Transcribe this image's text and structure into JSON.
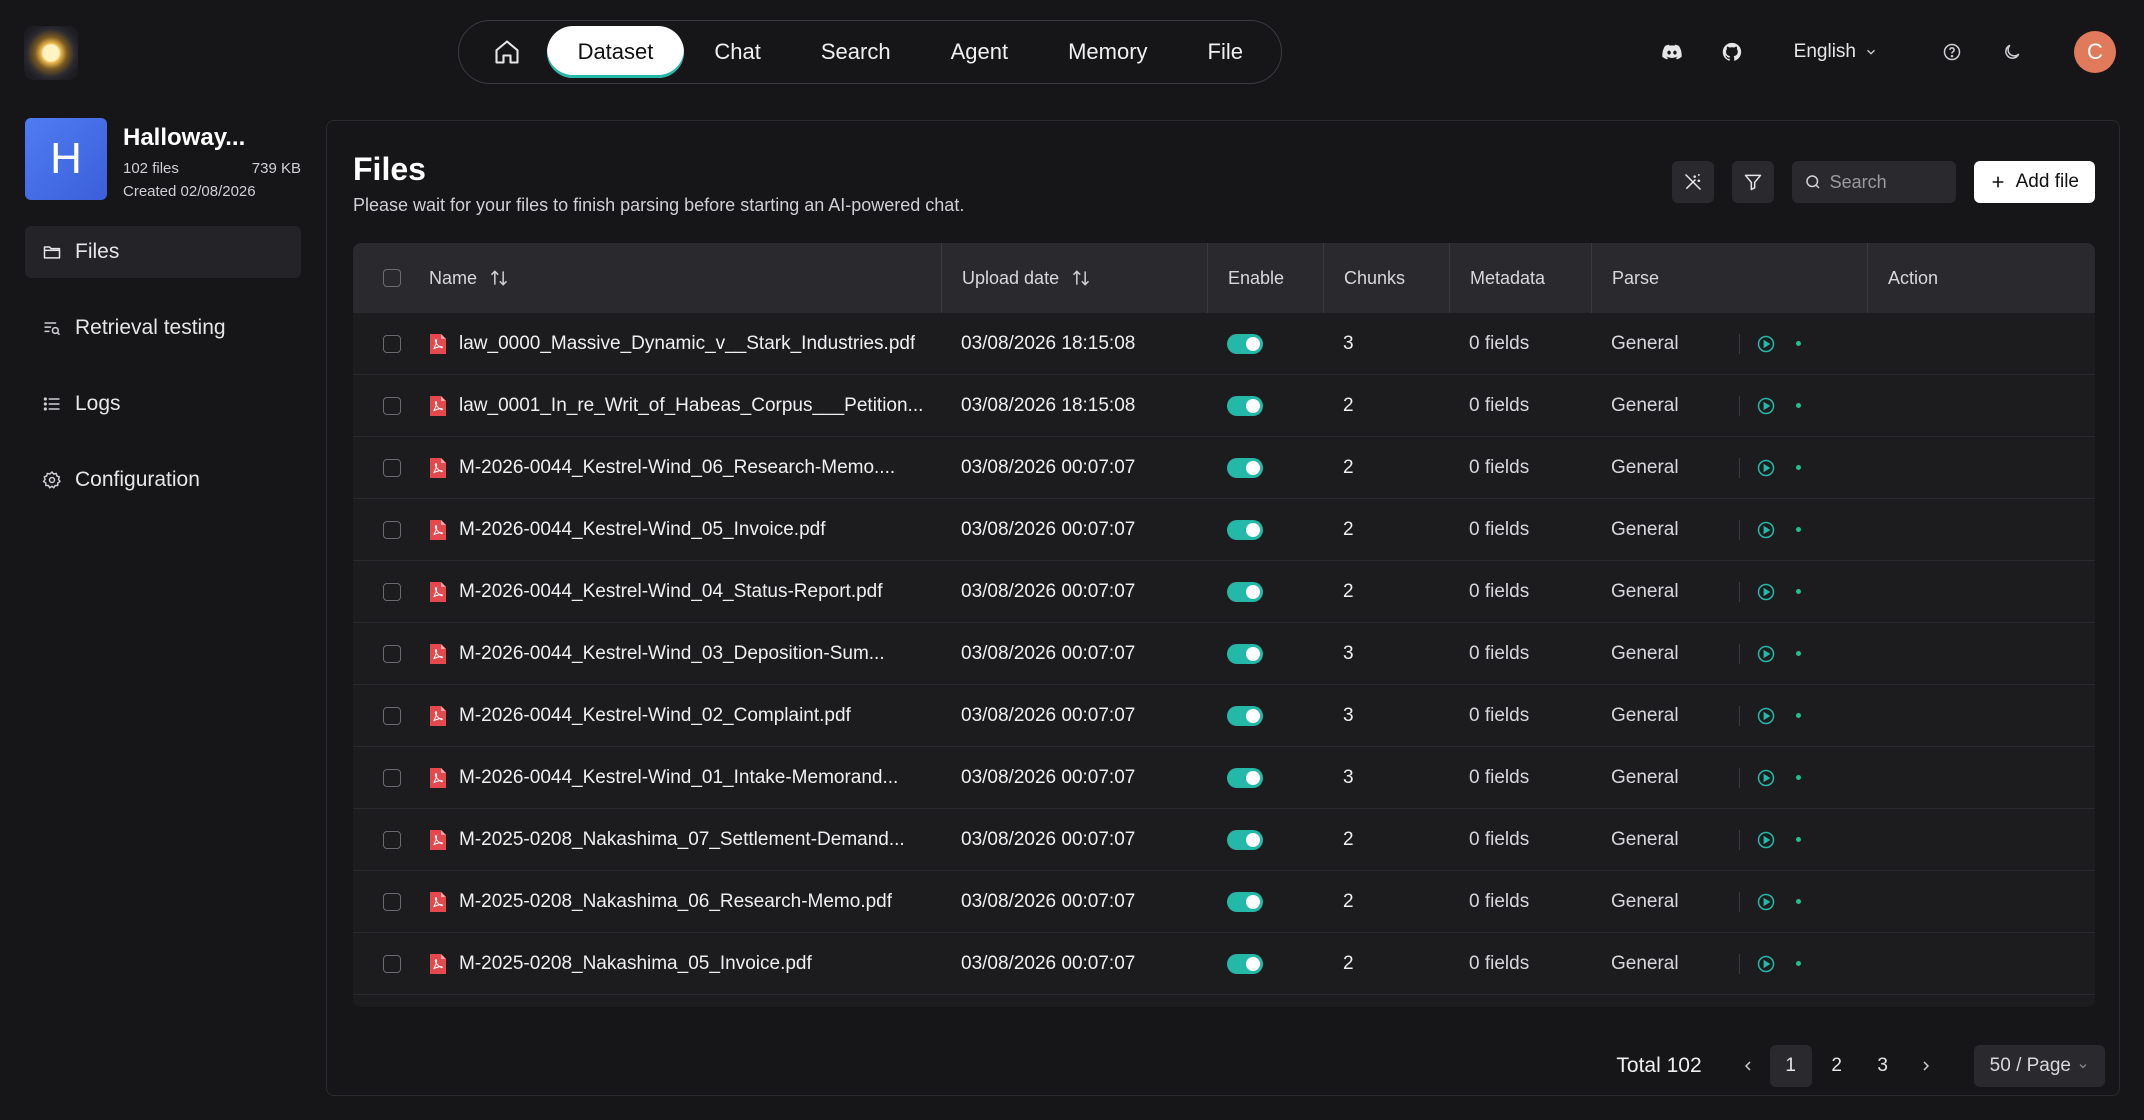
{
  "nav": {
    "items": [
      {
        "label": "Dataset",
        "active": true
      },
      {
        "label": "Chat",
        "active": false
      },
      {
        "label": "Search",
        "active": false
      },
      {
        "label": "Agent",
        "active": false
      },
      {
        "label": "Memory",
        "active": false
      },
      {
        "label": "File",
        "active": false
      }
    ]
  },
  "topright": {
    "language": "English",
    "avatar_initial": "C"
  },
  "dataset": {
    "thumb_letter": "H",
    "name": "Halloway...",
    "files": "102 files",
    "size": "739 KB",
    "created": "Created 02/08/2026"
  },
  "sidebar": {
    "items": [
      {
        "label": "Files",
        "icon": "folder-icon",
        "active": true
      },
      {
        "label": "Retrieval testing",
        "icon": "retrieval-icon",
        "active": false
      },
      {
        "label": "Logs",
        "icon": "list-icon",
        "active": false
      },
      {
        "label": "Configuration",
        "icon": "gear-icon",
        "active": false
      }
    ]
  },
  "page": {
    "title": "Files",
    "subtitle": "Please wait for your files to finish parsing before starting an AI-powered chat.",
    "search_placeholder": "Search",
    "add_file_label": "Add file"
  },
  "table": {
    "headers": {
      "name": "Name",
      "upload_date": "Upload date",
      "enable": "Enable",
      "chunks": "Chunks",
      "metadata": "Metadata",
      "parse": "Parse",
      "action": "Action"
    },
    "rows": [
      {
        "name": "law_0000_Massive_Dynamic_v__Stark_Industries.pdf",
        "date": "03/08/2026 18:15:08",
        "chunks": "3",
        "metadata": "0 fields",
        "parse": "General"
      },
      {
        "name": "law_0001_In_re_Writ_of_Habeas_Corpus___Petition...",
        "date": "03/08/2026 18:15:08",
        "chunks": "2",
        "metadata": "0 fields",
        "parse": "General"
      },
      {
        "name": "M-2026-0044_Kestrel-Wind_06_Research-Memo....",
        "date": "03/08/2026 00:07:07",
        "chunks": "2",
        "metadata": "0 fields",
        "parse": "General"
      },
      {
        "name": "M-2026-0044_Kestrel-Wind_05_Invoice.pdf",
        "date": "03/08/2026 00:07:07",
        "chunks": "2",
        "metadata": "0 fields",
        "parse": "General"
      },
      {
        "name": "M-2026-0044_Kestrel-Wind_04_Status-Report.pdf",
        "date": "03/08/2026 00:07:07",
        "chunks": "2",
        "metadata": "0 fields",
        "parse": "General"
      },
      {
        "name": "M-2026-0044_Kestrel-Wind_03_Deposition-Sum...",
        "date": "03/08/2026 00:07:07",
        "chunks": "3",
        "metadata": "0 fields",
        "parse": "General"
      },
      {
        "name": "M-2026-0044_Kestrel-Wind_02_Complaint.pdf",
        "date": "03/08/2026 00:07:07",
        "chunks": "3",
        "metadata": "0 fields",
        "parse": "General"
      },
      {
        "name": "M-2026-0044_Kestrel-Wind_01_Intake-Memorand...",
        "date": "03/08/2026 00:07:07",
        "chunks": "3",
        "metadata": "0 fields",
        "parse": "General"
      },
      {
        "name": "M-2025-0208_Nakashima_07_Settlement-Demand...",
        "date": "03/08/2026 00:07:07",
        "chunks": "2",
        "metadata": "0 fields",
        "parse": "General"
      },
      {
        "name": "M-2025-0208_Nakashima_06_Research-Memo.pdf",
        "date": "03/08/2026 00:07:07",
        "chunks": "2",
        "metadata": "0 fields",
        "parse": "General"
      },
      {
        "name": "M-2025-0208_Nakashima_05_Invoice.pdf",
        "date": "03/08/2026 00:07:07",
        "chunks": "2",
        "metadata": "0 fields",
        "parse": "General"
      }
    ]
  },
  "pagination": {
    "total": "Total 102",
    "pages": [
      "1",
      "2",
      "3"
    ],
    "current": "1",
    "page_size": "50 / Page"
  },
  "colors": {
    "accent": "#24b8a8",
    "status_dot": "#24c08a",
    "pdf": "#e5484d",
    "dataset_thumb": "#4f7cf3",
    "avatar": "#e07a5a"
  }
}
